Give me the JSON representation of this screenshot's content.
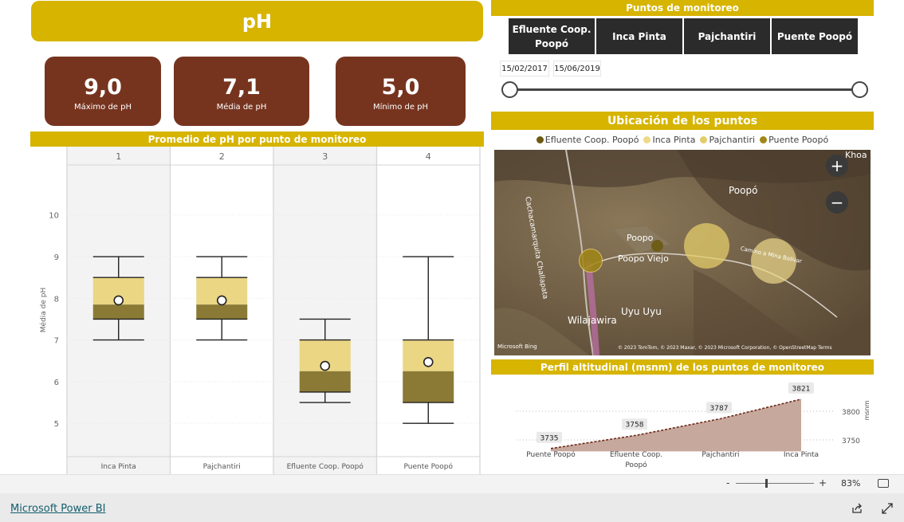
{
  "header": {
    "title": "pH"
  },
  "kpis": [
    {
      "value": "9,0",
      "label": "Máximo de pH"
    },
    {
      "value": "7,1",
      "label": "Média de pH"
    },
    {
      "value": "5,0",
      "label": "Mínimo de pH"
    }
  ],
  "boxplot_section": {
    "title": "Promedio de pH por punto de monitoreo"
  },
  "slicer": {
    "title": "Puntos de monitoreo",
    "buttons": [
      "Efluente Coop. Poopó",
      "Inca Pinta",
      "Pajchantiri",
      "Puente Poopó"
    ],
    "date_start": "15/02/2017",
    "date_end": "15/06/2019"
  },
  "map_section": {
    "title": "Ubicación de los puntos",
    "legend": [
      {
        "label": "Efluente Coop. Poopó",
        "color": "#6b5a12"
      },
      {
        "label": "Inca Pinta",
        "color": "#ecd98a"
      },
      {
        "label": "Pajchantiri",
        "color": "#e3cc6a"
      },
      {
        "label": "Puente Poopó",
        "color": "#a08616"
      }
    ],
    "places": [
      "Poopó",
      "Poopo",
      "Poopo Viejo",
      "Uyu Uyu",
      "Wilajawira",
      "Khoa",
      "Cachacamarquita Challapata",
      "Camino a Mina Bolívar"
    ],
    "attribution": "© 2023 TomTom, © 2023 Maxar, © 2023 Microsoft Corporation, © OpenStreetMap  Terms",
    "bing": "Microsoft Bing",
    "zoom_in": "+",
    "zoom_out": "−"
  },
  "profile_section": {
    "title": "Perfil altitudinal (msnm) de los puntos de monitoreo"
  },
  "chart_data": [
    {
      "type": "boxplot",
      "title": "Promedio de pH por punto de monitoreo",
      "ylabel": "Média de pH",
      "ylim": [
        4.2,
        11.2
      ],
      "yticks": [
        5,
        6,
        7,
        8,
        9,
        10
      ],
      "panels": [
        "1",
        "2",
        "3",
        "4"
      ],
      "categories": [
        "Inca Pinta",
        "Pajchantiri",
        "Efluente Coop. Poopó",
        "Puente Poopó"
      ],
      "boxes": [
        {
          "min": 7.0,
          "q1": 7.5,
          "median": 7.85,
          "q3": 8.5,
          "max": 9.0,
          "mean": 7.95
        },
        {
          "min": 7.0,
          "q1": 7.5,
          "median": 7.85,
          "q3": 8.5,
          "max": 9.0,
          "mean": 7.95
        },
        {
          "min": 5.5,
          "q1": 5.75,
          "median": 6.25,
          "q3": 7.0,
          "max": 7.5,
          "mean": 6.38
        },
        {
          "min": 5.0,
          "q1": 5.5,
          "median": 6.25,
          "q3": 7.0,
          "max": 9.0,
          "mean": 6.47
        }
      ],
      "colors": {
        "upper": "#ead683",
        "lower": "#8a7a35",
        "shade": "#f3f3f3"
      }
    },
    {
      "type": "area",
      "title": "Perfil altitudinal (msnm) de los puntos de monitoreo",
      "categories": [
        "Puente Poopó",
        "Efluente Coop. Poopó",
        "Pajchantiri",
        "Inca Pinta"
      ],
      "values": [
        3735,
        3758,
        3787,
        3821
      ],
      "ylabel": "msnm",
      "yticks": [
        3750,
        3800
      ],
      "ylim": [
        3730,
        3830
      ],
      "color": "#c4a397"
    }
  ],
  "status": {
    "zoom_minus": "-",
    "zoom_plus": "+",
    "zoom": "83%"
  },
  "footer": {
    "link": "Microsoft Power BI"
  }
}
